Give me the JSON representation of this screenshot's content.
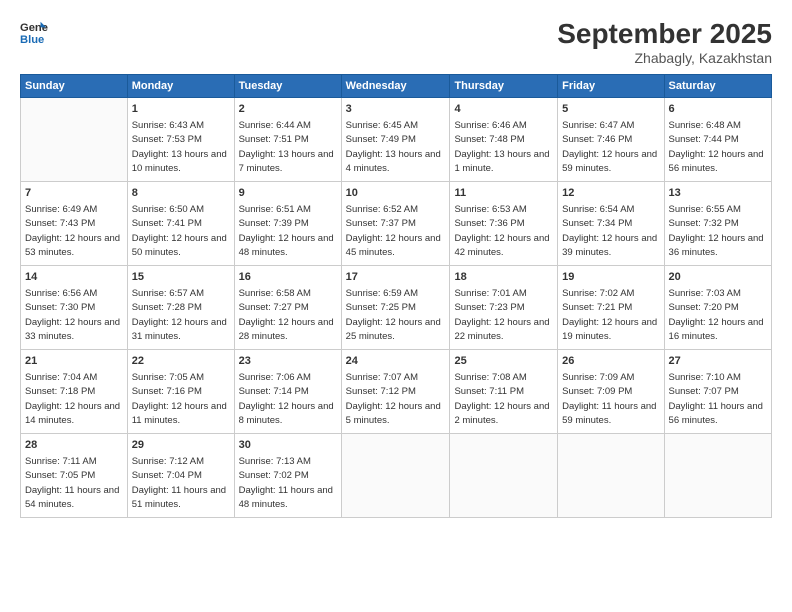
{
  "header": {
    "logo_line1": "General",
    "logo_line2": "Blue",
    "month": "September 2025",
    "location": "Zhabagly, Kazakhstan"
  },
  "weekdays": [
    "Sunday",
    "Monday",
    "Tuesday",
    "Wednesday",
    "Thursday",
    "Friday",
    "Saturday"
  ],
  "weeks": [
    [
      {
        "day": "",
        "sunrise": "",
        "sunset": "",
        "daylight": ""
      },
      {
        "day": "1",
        "sunrise": "Sunrise: 6:43 AM",
        "sunset": "Sunset: 7:53 PM",
        "daylight": "Daylight: 13 hours and 10 minutes."
      },
      {
        "day": "2",
        "sunrise": "Sunrise: 6:44 AM",
        "sunset": "Sunset: 7:51 PM",
        "daylight": "Daylight: 13 hours and 7 minutes."
      },
      {
        "day": "3",
        "sunrise": "Sunrise: 6:45 AM",
        "sunset": "Sunset: 7:49 PM",
        "daylight": "Daylight: 13 hours and 4 minutes."
      },
      {
        "day": "4",
        "sunrise": "Sunrise: 6:46 AM",
        "sunset": "Sunset: 7:48 PM",
        "daylight": "Daylight: 13 hours and 1 minute."
      },
      {
        "day": "5",
        "sunrise": "Sunrise: 6:47 AM",
        "sunset": "Sunset: 7:46 PM",
        "daylight": "Daylight: 12 hours and 59 minutes."
      },
      {
        "day": "6",
        "sunrise": "Sunrise: 6:48 AM",
        "sunset": "Sunset: 7:44 PM",
        "daylight": "Daylight: 12 hours and 56 minutes."
      }
    ],
    [
      {
        "day": "7",
        "sunrise": "Sunrise: 6:49 AM",
        "sunset": "Sunset: 7:43 PM",
        "daylight": "Daylight: 12 hours and 53 minutes."
      },
      {
        "day": "8",
        "sunrise": "Sunrise: 6:50 AM",
        "sunset": "Sunset: 7:41 PM",
        "daylight": "Daylight: 12 hours and 50 minutes."
      },
      {
        "day": "9",
        "sunrise": "Sunrise: 6:51 AM",
        "sunset": "Sunset: 7:39 PM",
        "daylight": "Daylight: 12 hours and 48 minutes."
      },
      {
        "day": "10",
        "sunrise": "Sunrise: 6:52 AM",
        "sunset": "Sunset: 7:37 PM",
        "daylight": "Daylight: 12 hours and 45 minutes."
      },
      {
        "day": "11",
        "sunrise": "Sunrise: 6:53 AM",
        "sunset": "Sunset: 7:36 PM",
        "daylight": "Daylight: 12 hours and 42 minutes."
      },
      {
        "day": "12",
        "sunrise": "Sunrise: 6:54 AM",
        "sunset": "Sunset: 7:34 PM",
        "daylight": "Daylight: 12 hours and 39 minutes."
      },
      {
        "day": "13",
        "sunrise": "Sunrise: 6:55 AM",
        "sunset": "Sunset: 7:32 PM",
        "daylight": "Daylight: 12 hours and 36 minutes."
      }
    ],
    [
      {
        "day": "14",
        "sunrise": "Sunrise: 6:56 AM",
        "sunset": "Sunset: 7:30 PM",
        "daylight": "Daylight: 12 hours and 33 minutes."
      },
      {
        "day": "15",
        "sunrise": "Sunrise: 6:57 AM",
        "sunset": "Sunset: 7:28 PM",
        "daylight": "Daylight: 12 hours and 31 minutes."
      },
      {
        "day": "16",
        "sunrise": "Sunrise: 6:58 AM",
        "sunset": "Sunset: 7:27 PM",
        "daylight": "Daylight: 12 hours and 28 minutes."
      },
      {
        "day": "17",
        "sunrise": "Sunrise: 6:59 AM",
        "sunset": "Sunset: 7:25 PM",
        "daylight": "Daylight: 12 hours and 25 minutes."
      },
      {
        "day": "18",
        "sunrise": "Sunrise: 7:01 AM",
        "sunset": "Sunset: 7:23 PM",
        "daylight": "Daylight: 12 hours and 22 minutes."
      },
      {
        "day": "19",
        "sunrise": "Sunrise: 7:02 AM",
        "sunset": "Sunset: 7:21 PM",
        "daylight": "Daylight: 12 hours and 19 minutes."
      },
      {
        "day": "20",
        "sunrise": "Sunrise: 7:03 AM",
        "sunset": "Sunset: 7:20 PM",
        "daylight": "Daylight: 12 hours and 16 minutes."
      }
    ],
    [
      {
        "day": "21",
        "sunrise": "Sunrise: 7:04 AM",
        "sunset": "Sunset: 7:18 PM",
        "daylight": "Daylight: 12 hours and 14 minutes."
      },
      {
        "day": "22",
        "sunrise": "Sunrise: 7:05 AM",
        "sunset": "Sunset: 7:16 PM",
        "daylight": "Daylight: 12 hours and 11 minutes."
      },
      {
        "day": "23",
        "sunrise": "Sunrise: 7:06 AM",
        "sunset": "Sunset: 7:14 PM",
        "daylight": "Daylight: 12 hours and 8 minutes."
      },
      {
        "day": "24",
        "sunrise": "Sunrise: 7:07 AM",
        "sunset": "Sunset: 7:12 PM",
        "daylight": "Daylight: 12 hours and 5 minutes."
      },
      {
        "day": "25",
        "sunrise": "Sunrise: 7:08 AM",
        "sunset": "Sunset: 7:11 PM",
        "daylight": "Daylight: 12 hours and 2 minutes."
      },
      {
        "day": "26",
        "sunrise": "Sunrise: 7:09 AM",
        "sunset": "Sunset: 7:09 PM",
        "daylight": "Daylight: 11 hours and 59 minutes."
      },
      {
        "day": "27",
        "sunrise": "Sunrise: 7:10 AM",
        "sunset": "Sunset: 7:07 PM",
        "daylight": "Daylight: 11 hours and 56 minutes."
      }
    ],
    [
      {
        "day": "28",
        "sunrise": "Sunrise: 7:11 AM",
        "sunset": "Sunset: 7:05 PM",
        "daylight": "Daylight: 11 hours and 54 minutes."
      },
      {
        "day": "29",
        "sunrise": "Sunrise: 7:12 AM",
        "sunset": "Sunset: 7:04 PM",
        "daylight": "Daylight: 11 hours and 51 minutes."
      },
      {
        "day": "30",
        "sunrise": "Sunrise: 7:13 AM",
        "sunset": "Sunset: 7:02 PM",
        "daylight": "Daylight: 11 hours and 48 minutes."
      },
      {
        "day": "",
        "sunrise": "",
        "sunset": "",
        "daylight": ""
      },
      {
        "day": "",
        "sunrise": "",
        "sunset": "",
        "daylight": ""
      },
      {
        "day": "",
        "sunrise": "",
        "sunset": "",
        "daylight": ""
      },
      {
        "day": "",
        "sunrise": "",
        "sunset": "",
        "daylight": ""
      }
    ]
  ]
}
